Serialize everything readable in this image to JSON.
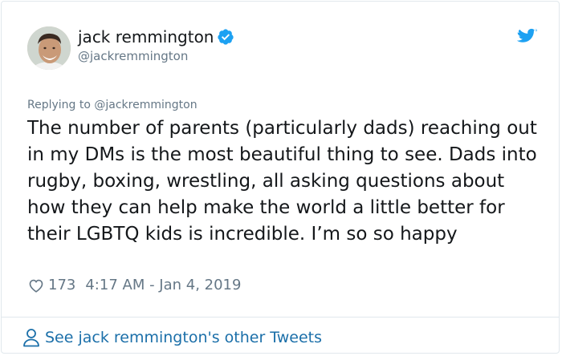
{
  "author": {
    "name": "jack remmington",
    "handle": "@jackremmington",
    "verified": true,
    "avatar_icon": "avatar-photo"
  },
  "reply": {
    "label": "Replying to",
    "handle": "@jackremmington"
  },
  "tweet": {
    "text": "The number of parents (particularly dads) reaching out in my DMs is the most beautiful thing to see. Dads into rugby, boxing, wrestling, all asking questions about how they can help make the world a little better for their LGBTQ kids is incredible. I’m so so happy",
    "likes": "173",
    "timestamp": "4:17 AM - Jan 4, 2019"
  },
  "footer": {
    "link_text": "See jack remmington's other Tweets"
  },
  "icons": {
    "brand": "twitter-bird-icon",
    "verified": "verified-badge-icon",
    "like": "heart-icon",
    "profile": "person-icon"
  },
  "colors": {
    "brand_blue": "#1da1f2",
    "link_blue": "#1b6fa9",
    "muted_text": "#657786",
    "primary_text": "#14171a",
    "border": "#e1e8ed"
  }
}
